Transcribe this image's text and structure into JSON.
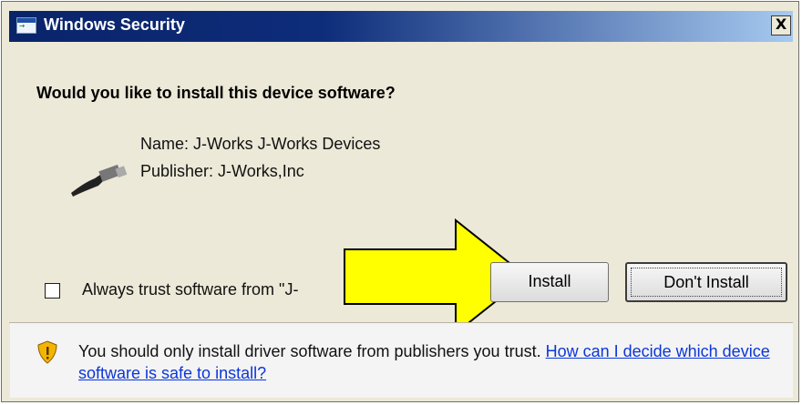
{
  "window": {
    "title": "Windows Security",
    "close_glyph": "X"
  },
  "dialog": {
    "question": "Would you like to install this device software?",
    "device_name": "Name: J-Works J-Works Devices",
    "publisher": "Publisher: J-Works,Inc",
    "trust_checkbox_label": "Always trust software from \"J-",
    "trust_checked": false,
    "install_button": "Install",
    "dont_install_button": "Don't Install"
  },
  "footer": {
    "warning_text": "You should only install driver software from publishers you trust. ",
    "help_link": "How can I decide which device software is safe to install?"
  },
  "icons": {
    "title": "windows-security-icon",
    "device": "usb-plug-icon",
    "footer": "shield-warning-icon",
    "annotation": "yellow-arrow-annotation"
  },
  "colors": {
    "titlebar_start": "#0a246a",
    "titlebar_end": "#a6caf0",
    "dialog_bg": "#ece9d8",
    "link": "#0b36d8",
    "arrow_fill": "#ffff00"
  }
}
